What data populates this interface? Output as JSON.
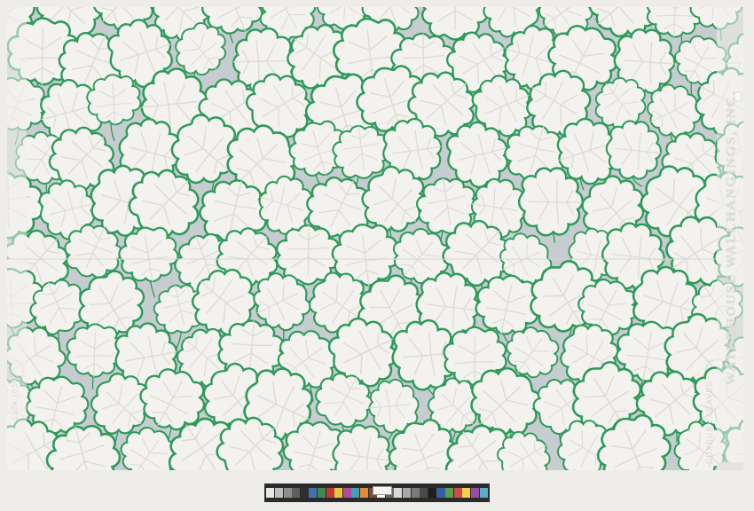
{
  "image": {
    "subject": "wallpaper-sample",
    "colors": {
      "background": "#eeede9",
      "ground": "#c6ccd0",
      "leaf_fill": "#f3f2ee",
      "leaf_vein": "#dedcd6",
      "outline_green": "#2e9a5a"
    }
  },
  "selvage": {
    "main_text": "WATERHOUSE WALLHANGINGS, INC.",
    "pattern_name": "DUXBURY LEAVES",
    "pattern_number": "1934 2030"
  },
  "color_bar": {
    "swatches": [
      "#e8e8e8",
      "#bdbdbd",
      "#8e8e8e",
      "#5f5f5f",
      "#2f2f2f",
      "#4a6fb0",
      "#3b8c4d",
      "#c03838",
      "#e2c63e",
      "#b44aa0",
      "#3f9fb6",
      "#e58a36",
      "#7c4a2c",
      "#ffffff",
      "#6a6a6a",
      "#d8d8d8",
      "#a8a8a8",
      "#7a7a7a",
      "#4a4a4a",
      "#1f1f1f",
      "#3a5fa0",
      "#5aa04f",
      "#d04c4c",
      "#f0d24a",
      "#9a4ca0",
      "#58b0c8"
    ]
  }
}
